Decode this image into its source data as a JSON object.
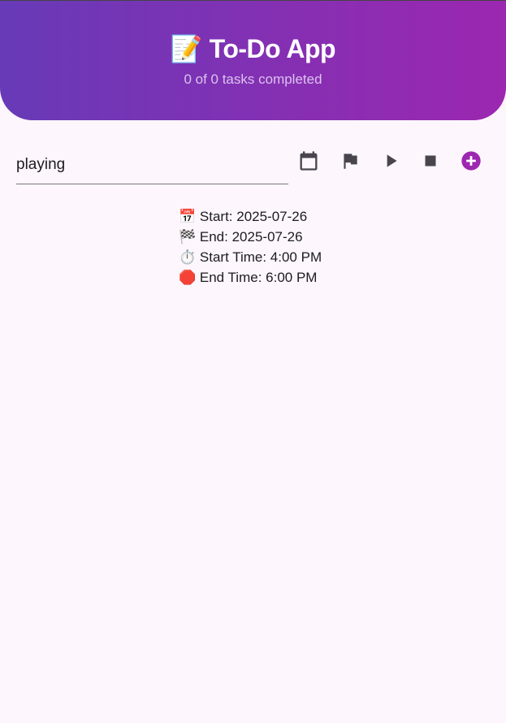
{
  "header": {
    "emoji": "📝",
    "title": "To-Do App",
    "subtitle": "0 of 0 tasks completed"
  },
  "task_input": {
    "value": "playing"
  },
  "toolbar": {
    "icons": [
      "calendar-icon",
      "flag-icon",
      "play-icon",
      "stop-icon",
      "add-circle-icon"
    ],
    "accent": "#9c27b0"
  },
  "info": {
    "start_date": "📅 Start: 2025-07-26",
    "end_date": "🏁 End: 2025-07-26",
    "start_time": "⏱️ Start Time: 4:00 PM",
    "end_time": "🛑 End Time: 6:00 PM"
  }
}
